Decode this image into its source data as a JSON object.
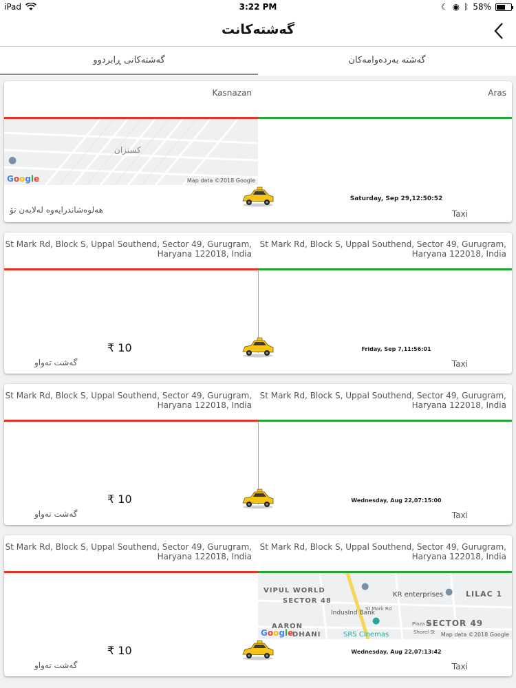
{
  "status_bar": {
    "device": "iPad",
    "time": "3:22 PM",
    "battery": "58%"
  },
  "header": {
    "title": "گەشتەکانت"
  },
  "tabs": [
    {
      "label": "گەشتە بەردەوامەکان",
      "active": false
    },
    {
      "label": "گەشتەکانی ڕابردوو",
      "active": true
    }
  ],
  "map_texts": {
    "credit": "Map data ©2018 Google",
    "google": "Google",
    "kasnazan_ar": "کسنزان",
    "vipul": "VIPUL WORLD",
    "sector48": "SECTOR 48",
    "indusind": "IndusInd Bank",
    "kr": "KR enterprises",
    "lilac": "LILAC 1",
    "sector49": "SECTOR 49",
    "aaron": "AARON",
    "dhani": "DHANI",
    "srs": "SRS Cinemas",
    "stmark": "St Mark Rd",
    "plaza": "Plaza St",
    "shorel": "Shorel St"
  },
  "trips": [
    {
      "pickup": "Aras",
      "drop": "Kasnazan",
      "date": "Saturday, Sep 29,12:50:52",
      "type": "Taxi",
      "price": "",
      "status": "هەلوەشاندرایەوە لەلایەن تۆ"
    },
    {
      "pickup": "St Mark Rd, Block S, Uppal Southend, Sector 49, Gurugram, Haryana 122018, India",
      "drop": "St Mark Rd, Block S, Uppal Southend, Sector 49, Gurugram, Haryana 122018, India",
      "date": "Friday, Sep 7,11:56:01",
      "type": "Taxi",
      "price": "₹ 10",
      "status": "گەشت تەواو"
    },
    {
      "pickup": "St Mark Rd, Block S, Uppal Southend, Sector 49, Gurugram, Haryana 122018, India",
      "drop": "St Mark Rd, Block S, Uppal Southend, Sector 49, Gurugram, Haryana 122018, India",
      "date": "Wednesday, Aug 22,07:15:00",
      "type": "Taxi",
      "price": "₹ 10",
      "status": "گەشت تەواو"
    },
    {
      "pickup": "St Mark Rd, Block S, Uppal Southend, Sector 49, Gurugram, Haryana 122018, India",
      "drop": "St Mark Rd, Block S, Uppal Southend, Sector 49, Gurugram, Haryana 122018, India",
      "date": "Wednesday, Aug 22,07:13:42",
      "type": "Taxi",
      "price": "₹ 10",
      "status": "گەشت تەواو"
    }
  ]
}
